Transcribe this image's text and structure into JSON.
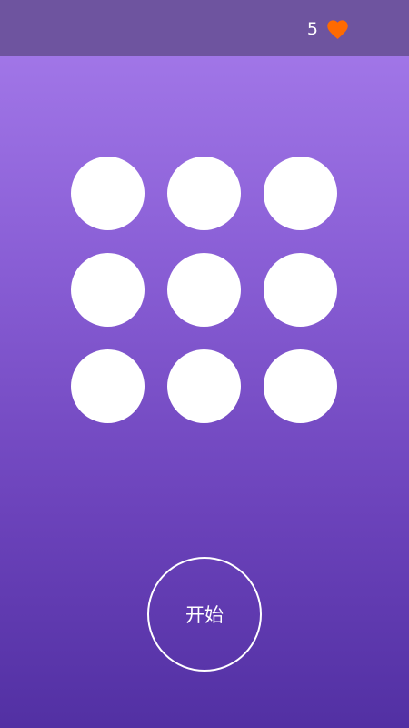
{
  "header": {
    "lives": "5",
    "heart_icon": "heart-icon",
    "heart_color": "#ff6a00"
  },
  "board": {
    "rows": 3,
    "cols": 3,
    "dot_color": "#ffffff"
  },
  "start_button": {
    "label": "开始"
  },
  "colors": {
    "header_bg": "#6e549f",
    "bg_top": "#a77cec",
    "bg_bottom": "#5230a3"
  }
}
